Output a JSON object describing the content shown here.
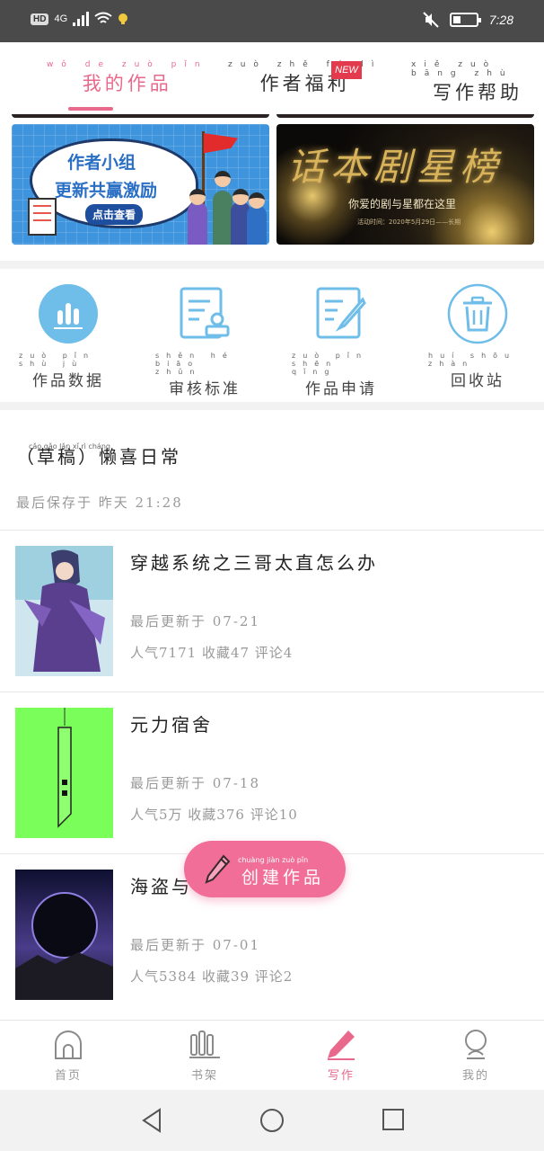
{
  "status_bar": {
    "hd": "HD",
    "network": "4G",
    "time": "7:28"
  },
  "top_tabs": [
    {
      "label": "我的作品",
      "pinyin": "wǒ de zuò pǐn"
    },
    {
      "label": "作者福利",
      "pinyin": "zuò zhě fú lì"
    },
    {
      "label": "写作帮助",
      "pinyin": "xiě zuò bāng zhù"
    }
  ],
  "new_badge": "NEW",
  "banners": {
    "left": {
      "line1": "作者小组",
      "line2": "更新共赢激励",
      "button": "点击查看"
    },
    "right": {
      "title": "话本剧星榜",
      "subtitle": "你爱的剧与星都在这里",
      "date": "活动时间：2020年5月29日——长期"
    }
  },
  "tools": [
    {
      "label": "作品数据",
      "pinyin": "zuò pǐn shù jù",
      "icon": "bar-chart-icon"
    },
    {
      "label": "审核标准",
      "pinyin": "shěn hé biāo zhǔn",
      "icon": "review-stamp-icon"
    },
    {
      "label": "作品申请",
      "pinyin": "zuò pǐn shēn qǐng",
      "icon": "edit-document-icon"
    },
    {
      "label": "回收站",
      "pinyin": "huí shōu zhàn",
      "icon": "trash-icon"
    }
  ],
  "draft": {
    "title": "（草稿）懒喜日常",
    "pinyin": "cǎo gǎo     lǎn xǐ rì cháng",
    "saved": "最后保存于 昨天 21:28"
  },
  "works": [
    {
      "title": "穿越系统之三哥太直怎么办",
      "updated": "最后更新于 07-21",
      "stats": "人气7171 收藏47 评论4"
    },
    {
      "title": "元力宿舍",
      "updated": "最后更新于 07-18",
      "stats": "人气5万 收藏376 评论10"
    },
    {
      "title": "海盗与",
      "updated": "最后更新于 07-01",
      "stats": "人气5384 收藏39 评论2"
    }
  ],
  "fab": {
    "label": "创建作品",
    "pinyin": "chuàng jiàn zuò pǐn"
  },
  "bottom_nav": [
    {
      "label": "首页",
      "icon": "home-icon"
    },
    {
      "label": "书架",
      "icon": "bookshelf-icon"
    },
    {
      "label": "写作",
      "icon": "pencil-icon"
    },
    {
      "label": "我的",
      "icon": "profile-icon"
    }
  ],
  "colors": {
    "accent": "#e8698c",
    "fab": "#f06e98",
    "icon_blue": "#5fb3e6"
  }
}
